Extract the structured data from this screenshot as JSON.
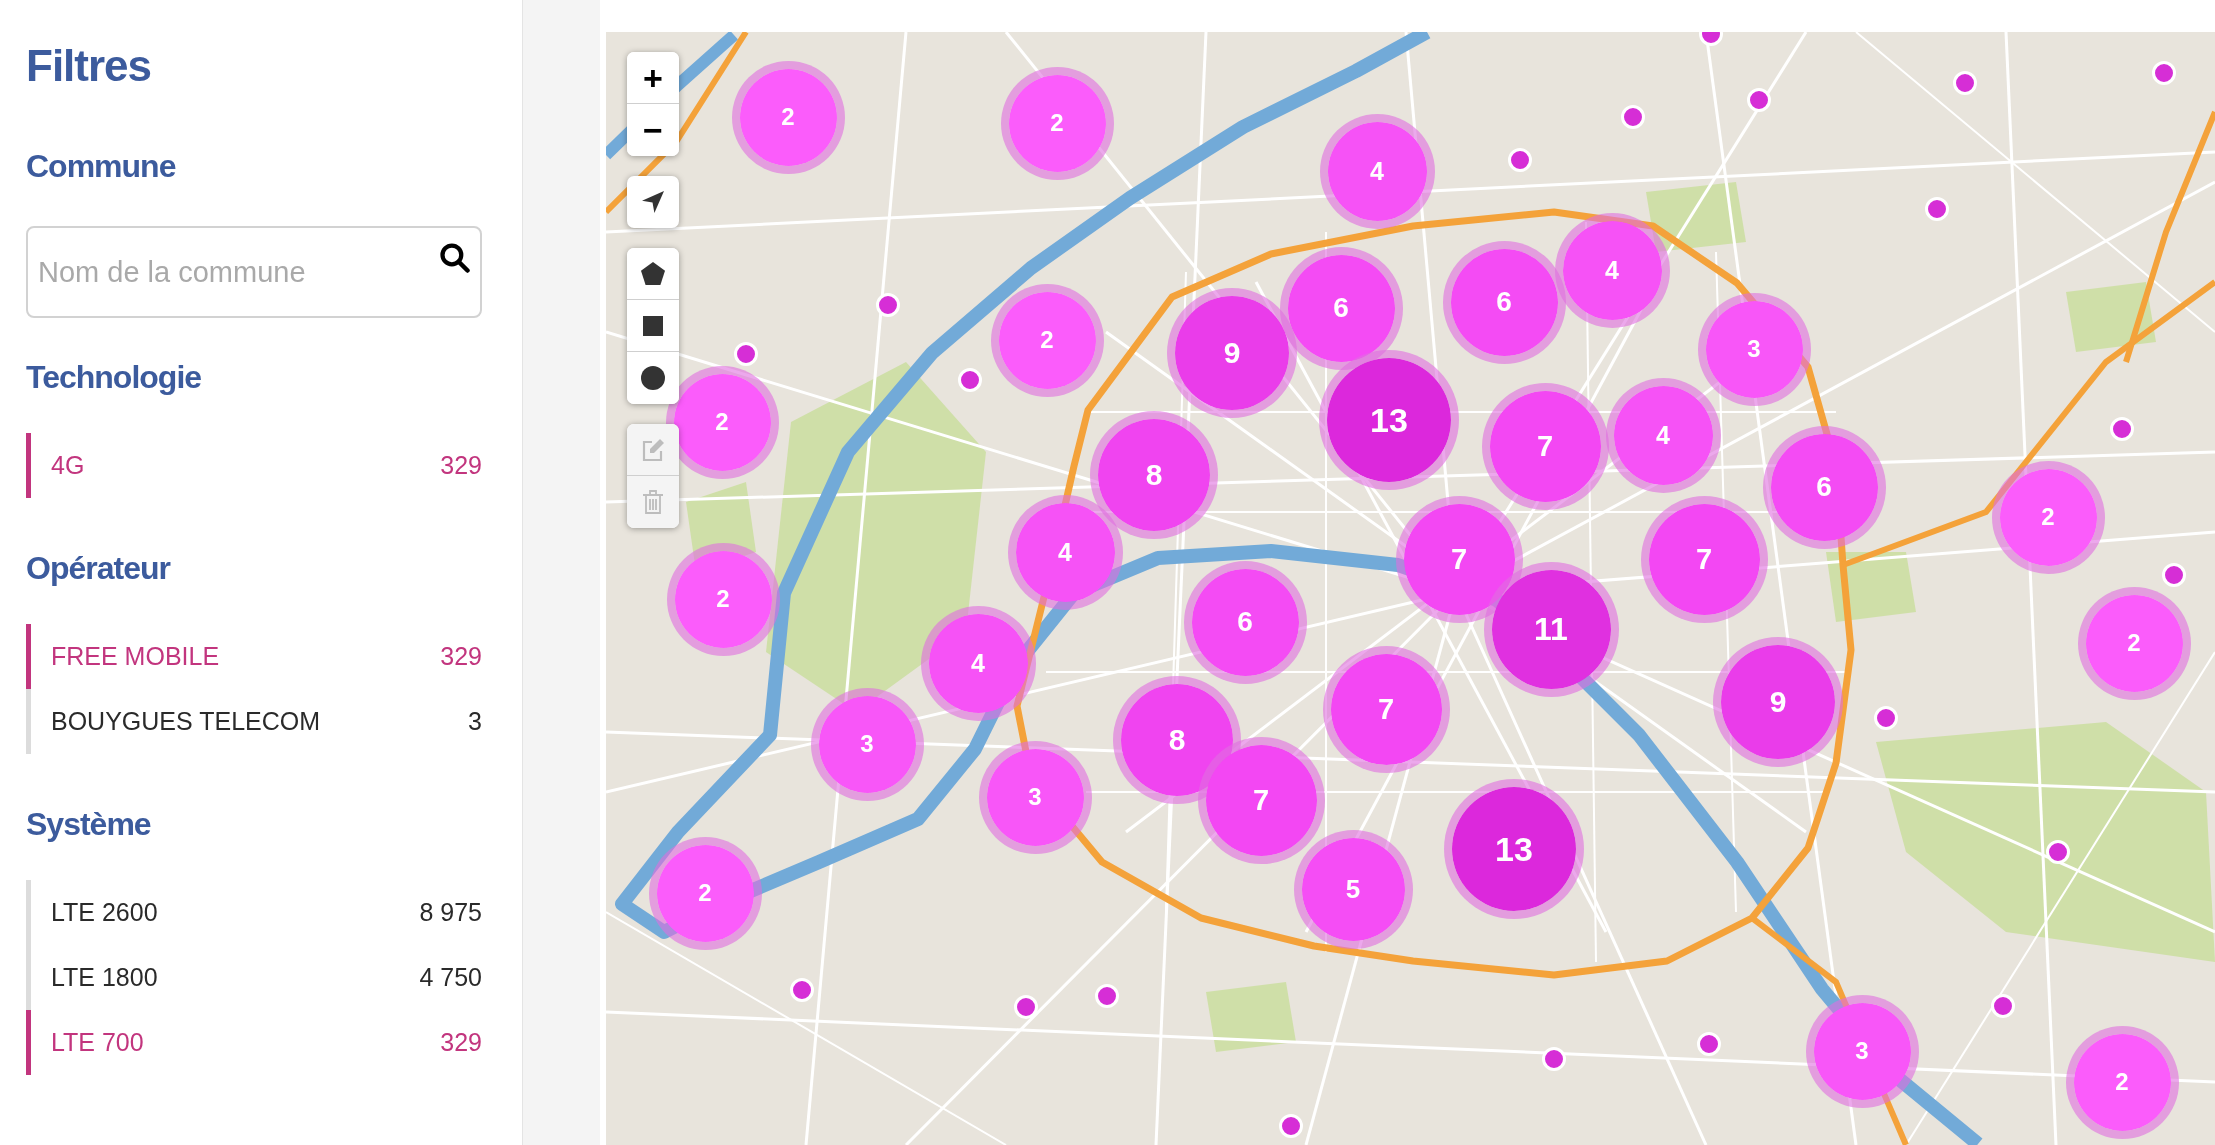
{
  "sidebar": {
    "title": "Filtres",
    "sections": [
      {
        "heading": "Commune",
        "kind": "search",
        "placeholder": "Nom de la commune"
      },
      {
        "heading": "Technologie",
        "kind": "list",
        "items": [
          {
            "label": "4G",
            "count": "329",
            "selected": true
          }
        ]
      },
      {
        "heading": "Opérateur",
        "kind": "list",
        "items": [
          {
            "label": "FREE MOBILE",
            "count": "329",
            "selected": true
          },
          {
            "label": "BOUYGUES TELECOM",
            "count": "3",
            "selected": false
          }
        ]
      },
      {
        "heading": "Système",
        "kind": "list",
        "items": [
          {
            "label": "LTE 2600",
            "count": "8 975",
            "selected": false
          },
          {
            "label": "LTE 1800",
            "count": "4 750",
            "selected": false
          },
          {
            "label": "LTE 700",
            "count": "329",
            "selected": true
          }
        ]
      }
    ]
  },
  "map": {
    "control_groups": [
      {
        "buttons": [
          {
            "kind": "zoom_in",
            "label": "+",
            "disabled": false
          },
          {
            "kind": "zoom_out",
            "label": "−",
            "disabled": false
          }
        ]
      },
      {
        "buttons": [
          {
            "kind": "locate",
            "disabled": false
          }
        ]
      },
      {
        "buttons": [
          {
            "kind": "polygon",
            "disabled": false
          },
          {
            "kind": "rectangle",
            "disabled": false
          },
          {
            "kind": "circle",
            "disabled": false
          }
        ]
      },
      {
        "buttons": [
          {
            "kind": "edit",
            "disabled": true
          },
          {
            "kind": "delete",
            "disabled": true
          }
        ]
      }
    ],
    "markers": [
      {
        "kind": "point",
        "color": "#d62ed6"
      },
      {
        "kind": "point",
        "color": "#d62ed6"
      },
      {
        "kind": "point",
        "color": "#d62ed6"
      },
      {
        "kind": "point",
        "color": "#d62ed6"
      },
      {
        "kind": "cluster",
        "count": "2",
        "color": "#fb5cfb"
      },
      {
        "kind": "cluster",
        "count": "2",
        "color": "#fb5cfb"
      },
      {
        "kind": "point",
        "color": "#d62ed6"
      },
      {
        "kind": "cluster",
        "count": "4",
        "color": "#f652f6"
      },
      {
        "kind": "point",
        "color": "#d62ed6"
      },
      {
        "kind": "point",
        "color": "#d62ed6"
      },
      {
        "kind": "cluster",
        "count": "4",
        "color": "#f652f6"
      },
      {
        "kind": "point",
        "color": "#d62ed6"
      },
      {
        "kind": "cluster",
        "count": "6",
        "color": "#f44bf4"
      },
      {
        "kind": "cluster",
        "count": "6",
        "color": "#f44bf4"
      },
      {
        "kind": "cluster",
        "count": "2",
        "color": "#fb5cfb"
      },
      {
        "kind": "cluster",
        "count": "9",
        "color": "#ea3cea"
      },
      {
        "kind": "cluster",
        "count": "3",
        "color": "#f856f8"
      },
      {
        "kind": "point",
        "color": "#d62ed6"
      },
      {
        "kind": "point",
        "color": "#d62ed6"
      },
      {
        "kind": "cluster",
        "count": "2",
        "color": "#fb5cfb"
      },
      {
        "kind": "cluster",
        "count": "13",
        "color": "#dc28dc"
      },
      {
        "kind": "cluster",
        "count": "7",
        "color": "#f347f3"
      },
      {
        "kind": "cluster",
        "count": "4",
        "color": "#f652f6"
      },
      {
        "kind": "point",
        "color": "#d62ed6"
      },
      {
        "kind": "cluster",
        "count": "8",
        "color": "#f044f0"
      },
      {
        "kind": "cluster",
        "count": "6",
        "color": "#f44bf4"
      },
      {
        "kind": "cluster",
        "count": "2",
        "color": "#fb5cfb"
      },
      {
        "kind": "cluster",
        "count": "4",
        "color": "#f652f6"
      },
      {
        "kind": "cluster",
        "count": "7",
        "color": "#f347f3"
      },
      {
        "kind": "cluster",
        "count": "7",
        "color": "#f347f3"
      },
      {
        "kind": "point",
        "color": "#d62ed6"
      },
      {
        "kind": "cluster",
        "count": "2",
        "color": "#fb5cfb"
      },
      {
        "kind": "cluster",
        "count": "6",
        "color": "#f44bf4"
      },
      {
        "kind": "cluster",
        "count": "11",
        "color": "#e030e0"
      },
      {
        "kind": "cluster",
        "count": "2",
        "color": "#fb5cfb"
      },
      {
        "kind": "cluster",
        "count": "4",
        "color": "#f652f6"
      },
      {
        "kind": "cluster",
        "count": "7",
        "color": "#f347f3"
      },
      {
        "kind": "cluster",
        "count": "9",
        "color": "#ea3cea"
      },
      {
        "kind": "point",
        "color": "#d62ed6"
      },
      {
        "kind": "cluster",
        "count": "3",
        "color": "#f856f8"
      },
      {
        "kind": "cluster",
        "count": "8",
        "color": "#f044f0"
      },
      {
        "kind": "cluster",
        "count": "3",
        "color": "#f856f8"
      },
      {
        "kind": "cluster",
        "count": "7",
        "color": "#f347f3"
      },
      {
        "kind": "cluster",
        "count": "13",
        "color": "#dc28dc"
      },
      {
        "kind": "point",
        "color": "#d62ed6"
      },
      {
        "kind": "cluster",
        "count": "2",
        "color": "#fb5cfb"
      },
      {
        "kind": "cluster",
        "count": "5",
        "color": "#f54df5"
      },
      {
        "kind": "point",
        "color": "#d62ed6"
      },
      {
        "kind": "point",
        "color": "#d62ed6"
      },
      {
        "kind": "point",
        "color": "#d62ed6"
      },
      {
        "kind": "point",
        "color": "#d62ed6"
      },
      {
        "kind": "point",
        "color": "#d62ed6"
      },
      {
        "kind": "point",
        "color": "#d62ed6"
      },
      {
        "kind": "cluster",
        "count": "3",
        "color": "#f856f8"
      },
      {
        "kind": "cluster",
        "count": "2",
        "color": "#fb5cfb"
      },
      {
        "kind": "point",
        "color": "#d62ed6"
      }
    ]
  }
}
